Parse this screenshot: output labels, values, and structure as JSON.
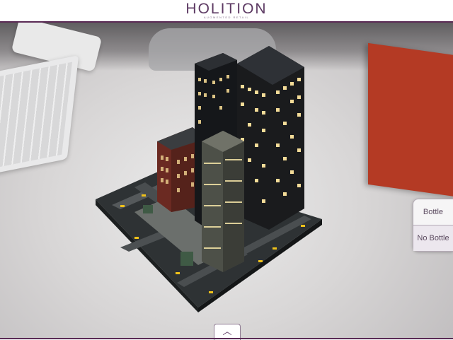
{
  "header": {
    "brand": "HOLITION",
    "tagline": "AUGMENTED RETAIL"
  },
  "options": {
    "bottle_label": "Bottle",
    "no_bottle_label": "No Bottle",
    "selected": "No Bottle"
  },
  "bottom_tab": {
    "icon": "chevron-up-icon",
    "glyph": "︿"
  },
  "colors": {
    "brand": "#5d3a63",
    "accent_line": "#5a2a55"
  }
}
